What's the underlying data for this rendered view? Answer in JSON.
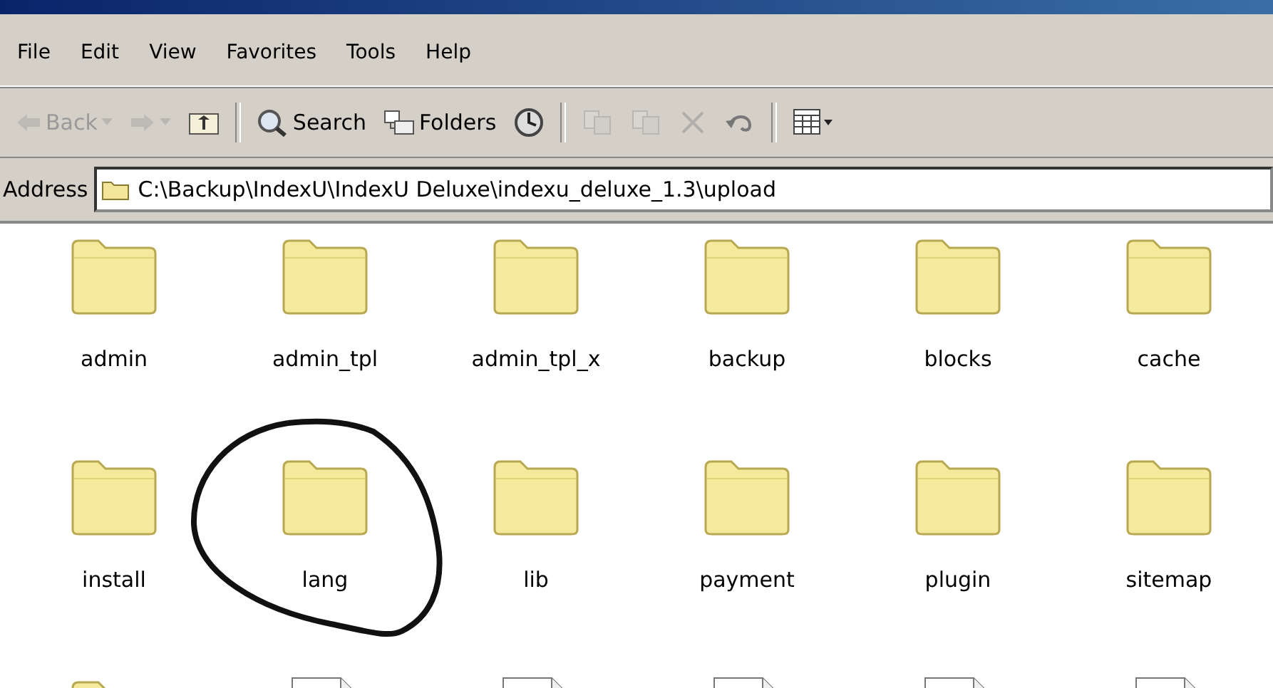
{
  "menu": [
    "File",
    "Edit",
    "View",
    "Favorites",
    "Tools",
    "Help"
  ],
  "toolbar": [
    {
      "kind": "back",
      "label": "Back",
      "disabled": true
    },
    {
      "kind": "forward",
      "disabled": true
    },
    {
      "kind": "up",
      "disabled": false
    },
    {
      "kind": "search",
      "label": "Search",
      "disabled": false
    },
    {
      "kind": "folders",
      "label": "Folders",
      "disabled": false
    },
    {
      "kind": "history",
      "disabled": false
    },
    {
      "kind": "move",
      "disabled": true
    },
    {
      "kind": "copy",
      "disabled": true
    },
    {
      "kind": "delete",
      "disabled": true
    },
    {
      "kind": "undo",
      "disabled": false
    },
    {
      "kind": "views",
      "disabled": false
    }
  ],
  "address": {
    "label": "Address",
    "value": "C:\\Backup\\IndexU\\IndexU Deluxe\\indexu_deluxe_1.3\\upload"
  },
  "items": [
    {
      "kind": "folder",
      "name": "admin"
    },
    {
      "kind": "folder",
      "name": "admin_tpl"
    },
    {
      "kind": "folder",
      "name": "admin_tpl_x"
    },
    {
      "kind": "folder",
      "name": "backup"
    },
    {
      "kind": "folder",
      "name": "blocks"
    },
    {
      "kind": "folder",
      "name": "cache"
    },
    {
      "kind": "folder",
      "name": "install"
    },
    {
      "kind": "folder",
      "name": "lang"
    },
    {
      "kind": "folder",
      "name": "lib"
    },
    {
      "kind": "folder",
      "name": "payment"
    },
    {
      "kind": "folder",
      "name": "plugin"
    },
    {
      "kind": "folder",
      "name": "sitemap"
    },
    {
      "kind": "folder"
    },
    {
      "kind": "file"
    },
    {
      "kind": "file"
    },
    {
      "kind": "file"
    },
    {
      "kind": "file"
    },
    {
      "kind": "file"
    }
  ]
}
